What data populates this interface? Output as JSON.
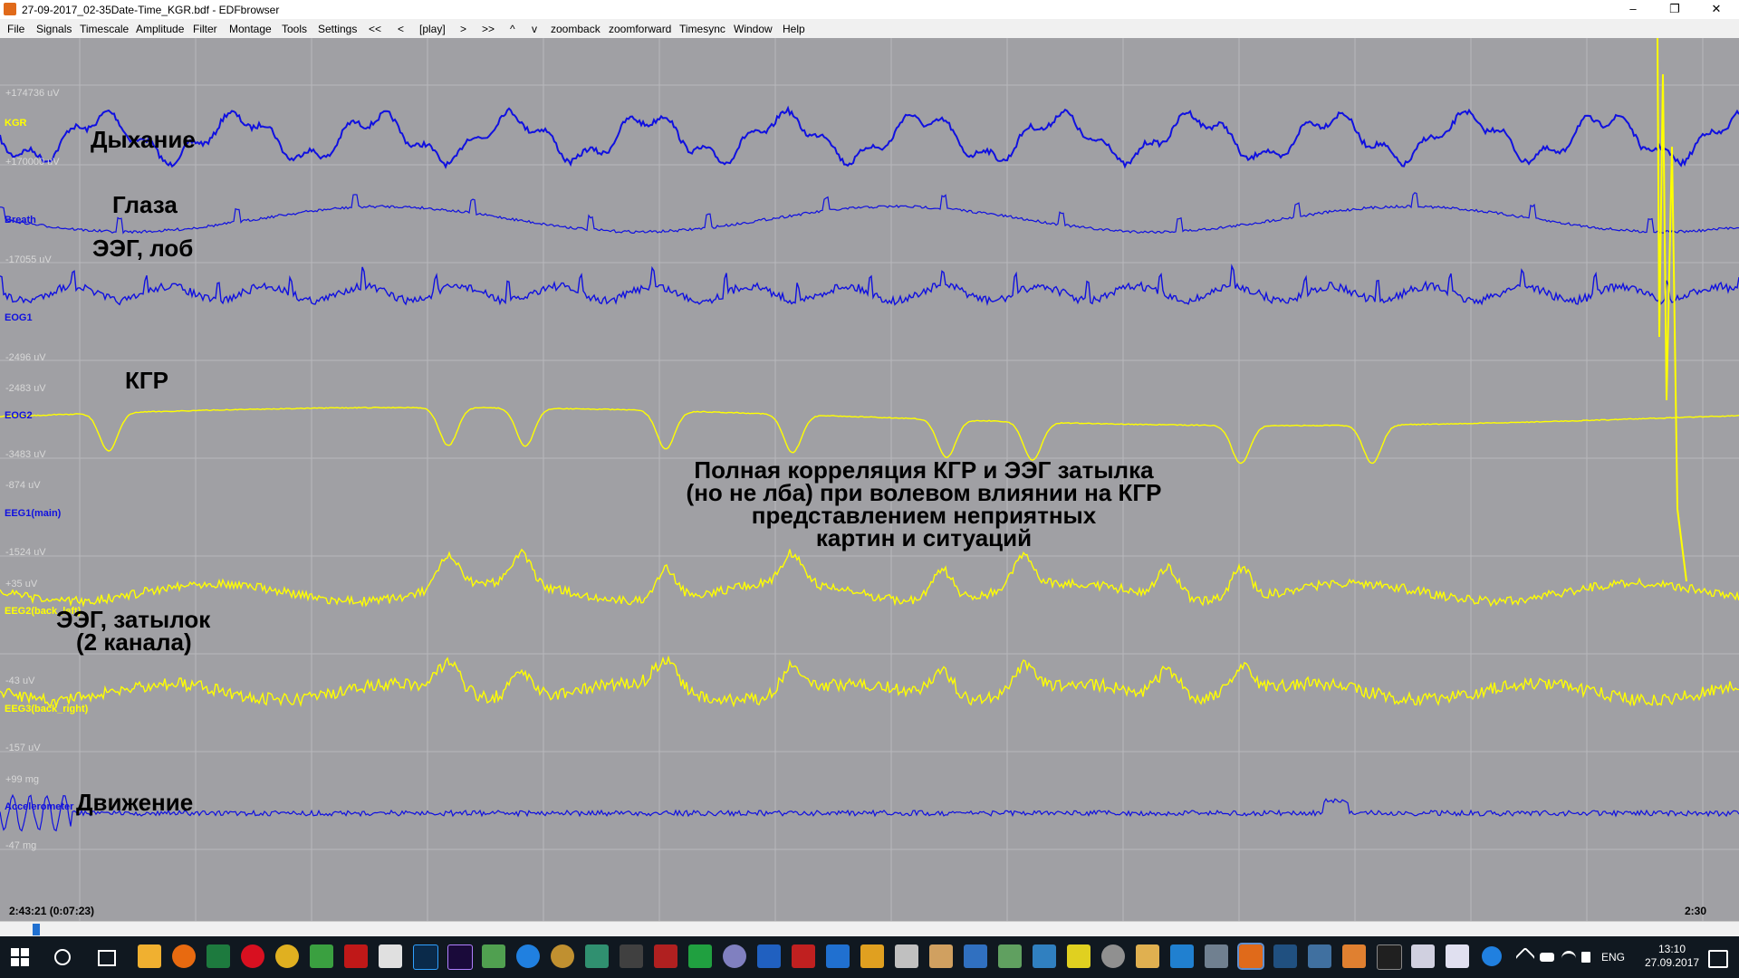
{
  "window": {
    "title": "27-09-2017_02-35Date-Time_KGR.bdf - EDFbrowser",
    "minimize": "–",
    "maximize": "❐",
    "close": "✕"
  },
  "menu": [
    "File",
    "Signals",
    "Timescale",
    "Amplitude",
    "Filter",
    "Montage",
    "Tools",
    "Settings",
    "<<",
    "<",
    "[play]",
    ">",
    ">>",
    "^",
    "v",
    "zoomback",
    "zoomforward",
    "Timesync",
    "Window",
    "Help"
  ],
  "ticks": [
    "+174736 uV",
    "+170000 uV",
    "-17055 uV",
    "-2496 uV",
    "-2483 uV",
    "-3483 uV",
    "-874 uV",
    "-1524 uV",
    "+35 uV",
    "-43 uV",
    "-157 uV",
    "+99 mg",
    "-47 mg"
  ],
  "channels": [
    "KGR",
    "Breath",
    "EOG1",
    "EOG2",
    "EEG1(main)",
    "EEG2(back_left)",
    "EEG3(back_right)",
    "Accelerometer"
  ],
  "annotations": {
    "breathing": "Дыхание",
    "eyes": "Глаза",
    "eeg_forehead": "ЭЭГ, лоб",
    "kgr": "КГР",
    "eeg_occipital_1": "ЭЭГ, затылок",
    "eeg_occipital_2": "(2 канала)",
    "movement": "Движение",
    "note": [
      "Полная корреляция КГР и ЭЭГ затылка",
      "(но не лба) при волевом влиянии на КГР",
      "представлением неприятных",
      "картин и ситуаций"
    ]
  },
  "time": {
    "left": "2:43:21 (0:07:23)",
    "right": "2:30"
  },
  "tray": {
    "lang": "ENG",
    "clock": "13:10",
    "date": "27.09.2017"
  },
  "colors": {
    "blue_trace": "#1010e0",
    "yellow_trace": "#ffff00",
    "plot_bg": "#a0a0a4",
    "grid": "#b8b8bc"
  }
}
